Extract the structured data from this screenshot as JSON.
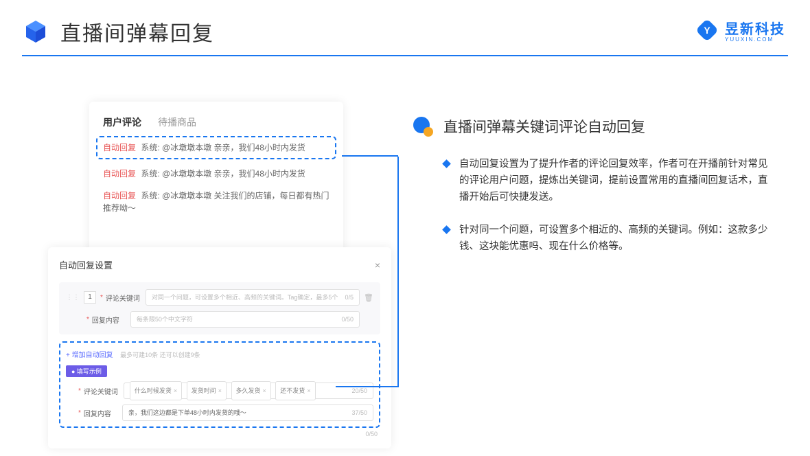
{
  "header": {
    "title": "直播间弹幕回复",
    "brand_name": "昱新科技",
    "brand_sub": "YUUXIN.COM"
  },
  "comments": {
    "tab_active": "用户评论",
    "tab_inactive": "待播商品",
    "reply_tag": "自动回复",
    "row1": "系统: @冰墩墩本墩 亲亲，我们48小时内发货",
    "row2": "系统: @冰墩墩本墩 亲亲，我们48小时内发货",
    "row3": "系统: @冰墩墩本墩 关注我们的店铺，每日都有热门推荐呦～"
  },
  "settings": {
    "title": "自动回复设置",
    "row_num": "1",
    "keyword_label": "评论关键词",
    "keyword_placeholder": "对同一个问题，可设置多个相近、高频的关键词。Tag确定，最多5个",
    "keyword_count": "0/5",
    "content_label": "回复内容",
    "content_placeholder": "每条限50个中文字符",
    "content_count": "0/50",
    "count_050": "0/50",
    "add_link": "+ 增加自动回复",
    "add_hint": "最多可建10条 还可以创建9条",
    "example_tag": "● 填写示例",
    "ex_keyword_label": "评论关键词",
    "ex_tag1": "什么时候发货",
    "ex_tag2": "发货时间",
    "ex_tag3": "多久发货",
    "ex_tag4": "还不发货",
    "ex_keyword_count": "20/50",
    "ex_content_label": "回复内容",
    "ex_content_value": "亲，我们这边都是下单48小时内发货的哦～",
    "ex_content_count": "37/50"
  },
  "right": {
    "section_title": "直播间弹幕关键词评论自动回复",
    "bullet1": "自动回复设置为了提升作者的评论回复效率，作者可在开播前针对常见的评论用户问题，提炼出关键词，提前设置常用的直播间回复话术，直播开始后可快捷发送。",
    "bullet2": "针对同一个问题，可设置多个相近的、高频的关键词。例如：这款多少钱、这块能优惠吗、现在什么价格等。"
  }
}
